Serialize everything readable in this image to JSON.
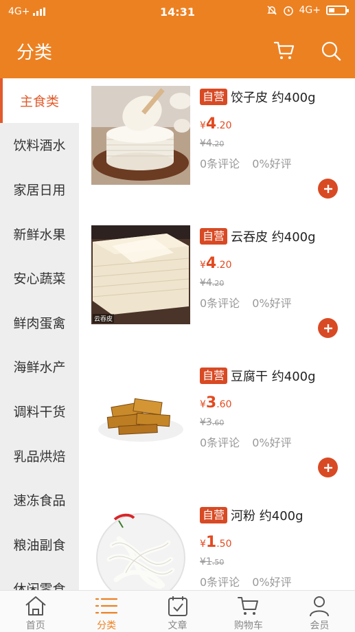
{
  "status_bar": {
    "network_left": "4G+",
    "time": "14:31",
    "network_right": "4G+"
  },
  "header": {
    "title": "分类",
    "cart_icon": "cart-icon",
    "search_icon": "search-icon"
  },
  "colors": {
    "brand": "#ec8122",
    "accent_red": "#d84a24",
    "price": "#e24a1f"
  },
  "sidebar": {
    "items": [
      {
        "label": "主食类"
      },
      {
        "label": "饮料酒水"
      },
      {
        "label": "家居日用"
      },
      {
        "label": "新鲜水果"
      },
      {
        "label": "安心蔬菜"
      },
      {
        "label": "鲜肉蛋禽"
      },
      {
        "label": "海鲜水产"
      },
      {
        "label": "调料干货"
      },
      {
        "label": "乳品烘焙"
      },
      {
        "label": "速冻食品"
      },
      {
        "label": "粮油副食"
      },
      {
        "label": "休闲零食"
      }
    ]
  },
  "products": [
    {
      "badge": "自营",
      "name": "饺子皮 约400g",
      "currency": "¥",
      "price_int": "4",
      "price_dec": ".20",
      "old_price_int": "¥4",
      "old_price_dec": ".20",
      "reviews": "0条评论",
      "rating": "0%好评"
    },
    {
      "badge": "自营",
      "name": "云吞皮 约400g",
      "currency": "¥",
      "price_int": "4",
      "price_dec": ".20",
      "old_price_int": "¥4",
      "old_price_dec": ".20",
      "reviews": "0条评论",
      "rating": "0%好评",
      "image_caption": "云吞皮"
    },
    {
      "badge": "自营",
      "name": "豆腐干 约400g",
      "currency": "¥",
      "price_int": "3",
      "price_dec": ".60",
      "old_price_int": "¥3",
      "old_price_dec": ".60",
      "reviews": "0条评论",
      "rating": "0%好评"
    },
    {
      "badge": "自营",
      "name": "河粉 约400g",
      "currency": "¥",
      "price_int": "1",
      "price_dec": ".50",
      "old_price_int": "¥1",
      "old_price_dec": ".50",
      "reviews": "0条评论",
      "rating": "0%好评"
    }
  ],
  "bottom_nav": {
    "items": [
      {
        "label": "首页",
        "icon": "home-icon"
      },
      {
        "label": "分类",
        "icon": "category-list-icon"
      },
      {
        "label": "文章",
        "icon": "article-calendar-icon"
      },
      {
        "label": "购物车",
        "icon": "cart-icon"
      },
      {
        "label": "会员",
        "icon": "member-icon"
      }
    ]
  }
}
